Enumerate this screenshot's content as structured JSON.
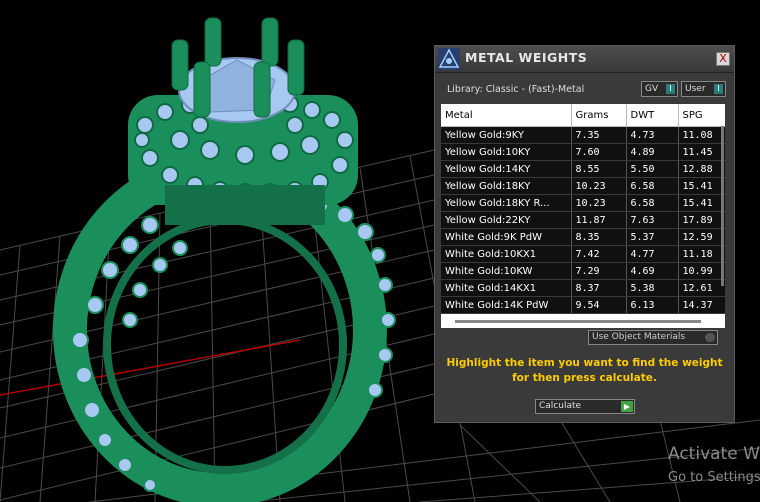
{
  "panel": {
    "title": "METAL WEIGHTS",
    "close_label": "X",
    "library_label": "Library: Classic - (Fast)-Metal",
    "gv_toggle": "GV",
    "gv_indicator": "I",
    "user_toggle": "User",
    "user_indicator": "I",
    "table": {
      "columns": [
        "Metal",
        "Grams",
        "DWT",
        "SPG"
      ],
      "rows": [
        [
          "Yellow Gold:9KY",
          "7.35",
          "4.73",
          "11.08"
        ],
        [
          "Yellow Gold:10KY",
          "7.60",
          "4.89",
          "11.45"
        ],
        [
          "Yellow Gold:14KY",
          "8.55",
          "5.50",
          "12.88"
        ],
        [
          "Yellow Gold:18KY",
          "10.23",
          "6.58",
          "15.41"
        ],
        [
          "Yellow Gold:18KY R...",
          "10.23",
          "6.58",
          "15.41"
        ],
        [
          "Yellow Gold:22KY",
          "11.87",
          "7.63",
          "17.89"
        ],
        [
          "White Gold:9K PdW",
          "8.35",
          "5.37",
          "12.59"
        ],
        [
          "White Gold:10KX1",
          "7.42",
          "4.77",
          "11.18"
        ],
        [
          "White Gold:10KW",
          "7.29",
          "4.69",
          "10.99"
        ],
        [
          "White Gold:14KX1",
          "8.37",
          "5.38",
          "12.61"
        ],
        [
          "White Gold:14K PdW",
          "9.54",
          "6.13",
          "14.37"
        ]
      ]
    },
    "use_object_materials": "Use Object Materials",
    "instruction_line1": "Highlight the item you want to find the weight",
    "instruction_line2": "for then press calculate.",
    "calculate_label": "Calculate",
    "calculate_arrow": "▶"
  },
  "watermark": {
    "line1": "Activate W",
    "line2": "Go to Settings"
  },
  "colors": {
    "ring_green": "#1a8f5c",
    "stone_blue": "#a7c8f0",
    "grid": "#555555",
    "axis_red": "#b00000",
    "instruction_yellow": "#ffcc00"
  },
  "icons": [
    "app-logo-icon",
    "close-icon",
    "play-arrow-icon"
  ]
}
